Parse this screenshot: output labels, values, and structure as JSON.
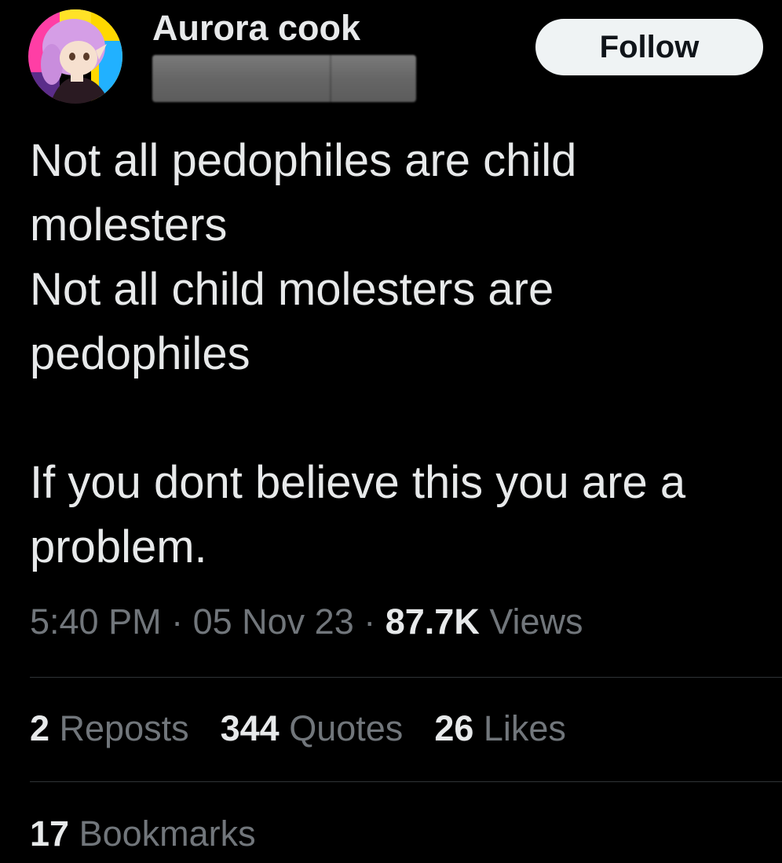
{
  "author": {
    "display_name": "Aurora cook",
    "handle_redacted": true
  },
  "follow_label": "Follow",
  "tweet": {
    "lines": [
      "Not all pedophiles are child",
      "molesters",
      "Not all child molesters are",
      "pedophiles",
      "",
      "If you dont believe this you are a",
      "problem."
    ]
  },
  "meta": {
    "time": "5:40 PM",
    "sep1": " · ",
    "date": "05 Nov 23",
    "sep2": " · ",
    "views_count": "87.7K",
    "views_label": " Views"
  },
  "stats": {
    "reposts_count": "2",
    "reposts_label": " Reposts",
    "quotes_count": "344",
    "quotes_label": " Quotes",
    "likes_count": "26",
    "likes_label": " Likes",
    "bookmarks_count": "17",
    "bookmarks_label": " Bookmarks"
  },
  "colors": {
    "background": "#000000",
    "primary_text": "#e7e9ea",
    "secondary_text": "#71767b",
    "divider": "#2f3336",
    "follow_bg": "#eff3f4",
    "follow_text": "#0f1419"
  },
  "icons": {
    "avatar": "anime-character-avatar-with-pride-flag-background"
  }
}
